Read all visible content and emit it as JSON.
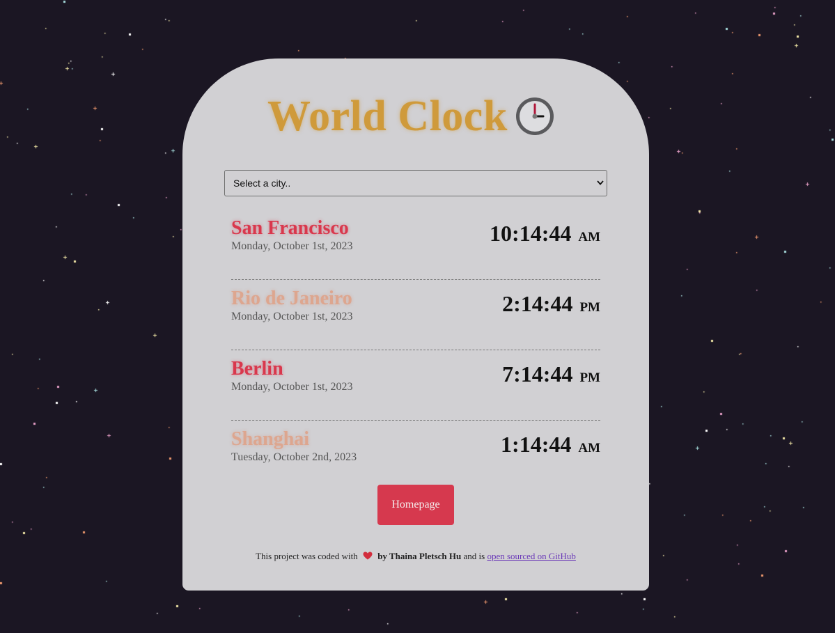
{
  "colors": {
    "background": "#1b1623",
    "card": "#d1d0d3",
    "title": "#cf9a3b",
    "accent": "#d9384d",
    "accent_soft": "#dda68f",
    "button": "#d6394e",
    "link": "#6b3ab8"
  },
  "header": {
    "title": "World Clock",
    "icon": "clock-icon"
  },
  "city_select": {
    "selected": "Select a city.."
  },
  "cities": [
    {
      "name": "San Francisco",
      "date": "Monday, October 1st, 2023",
      "time": "10:14:44",
      "ampm": "AM",
      "style": "strong"
    },
    {
      "name": "Rio de Janeiro",
      "date": "Monday, October 1st, 2023",
      "time": "2:14:44",
      "ampm": "PM",
      "style": "soft"
    },
    {
      "name": "Berlin",
      "date": "Monday, October 1st, 2023",
      "time": "7:14:44",
      "ampm": "PM",
      "style": "strong"
    },
    {
      "name": "Shanghai",
      "date": "Tuesday, October 2nd, 2023",
      "time": "1:14:44",
      "ampm": "AM",
      "style": "soft"
    }
  ],
  "homepage_button": {
    "label": "Homepage"
  },
  "footer": {
    "prefix": "This project was coded with",
    "heart_icon": "heart-icon",
    "author": "by Thaina Pletsch Hu",
    "middle": "and is",
    "link_text": "open sourced on GitHub"
  }
}
